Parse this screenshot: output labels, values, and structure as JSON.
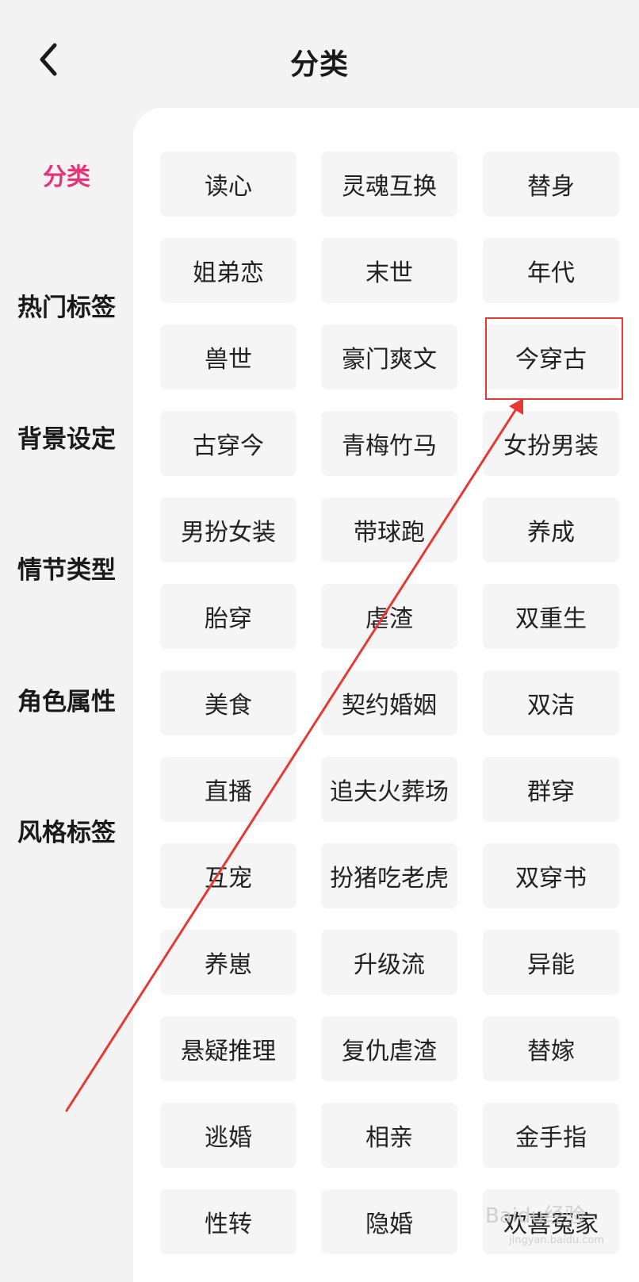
{
  "header": {
    "title": "分类",
    "back_icon": "chevron-left-icon"
  },
  "sidebar": {
    "items": [
      {
        "label": "分类",
        "active": true
      },
      {
        "label": "热门标签"
      },
      {
        "label": "背景设定"
      },
      {
        "label": "情节类型"
      },
      {
        "label": "角色属性"
      },
      {
        "label": "风格标签"
      }
    ]
  },
  "tags": [
    "读心",
    "灵魂互换",
    "替身",
    "姐弟恋",
    "末世",
    "年代",
    "兽世",
    "豪门爽文",
    "今穿古",
    "古穿今",
    "青梅竹马",
    "女扮男装",
    "男扮女装",
    "带球跑",
    "养成",
    "胎穿",
    "虐渣",
    "双重生",
    "美食",
    "契约婚姻",
    "双洁",
    "直播",
    "追夫火葬场",
    "群穿",
    "互宠",
    "扮猪吃老虎",
    "双穿书",
    "养崽",
    "升级流",
    "异能",
    "悬疑推理",
    "复仇虐渣",
    "替嫁",
    "逃婚",
    "相亲",
    "金手指",
    "性转",
    "隐婚",
    "欢喜冤家"
  ],
  "annotation": {
    "highlighted_tag": "今穿古",
    "color": "#e53935"
  },
  "colors": {
    "accent": "#e8327a",
    "tag_bg": "#f5f5f5",
    "page_bg": "#f3f3f3"
  },
  "watermark": {
    "text": "Baidu经验",
    "sub": "jingyan.baidu.com"
  }
}
